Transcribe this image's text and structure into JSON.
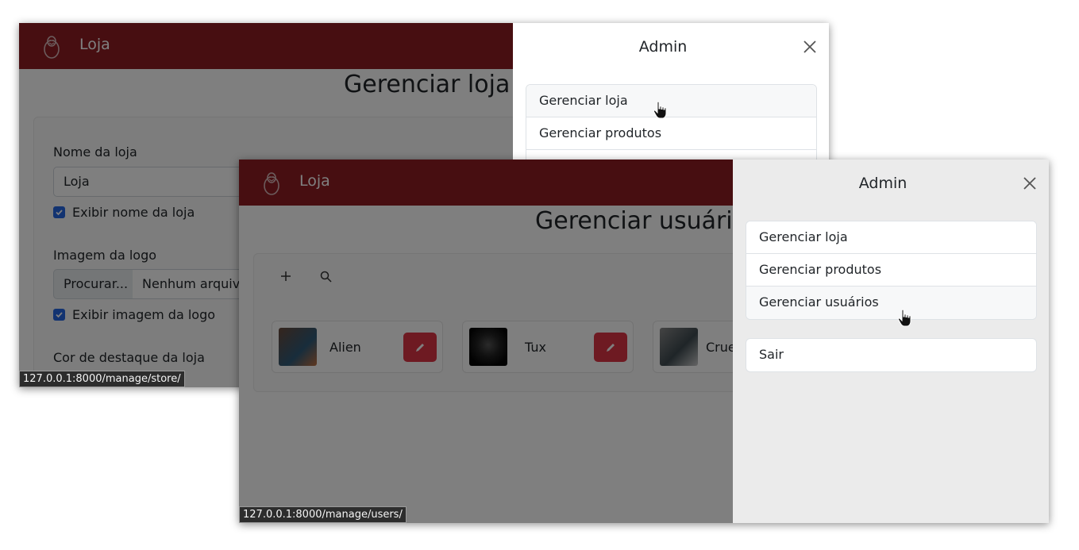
{
  "back_window": {
    "brand": {
      "name": "Loja",
      "logo_icon": "penguin-logo-icon"
    },
    "page_title": "Gerenciar loja",
    "form": {
      "store_name_label": "Nome da loja",
      "store_name_value": "Loja",
      "show_name_label": "Exibir nome da loja",
      "show_name_checked": true,
      "logo_label": "Imagem da logo",
      "browse_label": "Procurar...",
      "no_file_label": "Nenhum arquivo",
      "show_logo_label": "Exibir imagem da logo",
      "show_logo_checked": true,
      "accent_color_label": "Cor de destaque da loja"
    },
    "offcanvas": {
      "title": "Admin",
      "items": [
        "Gerenciar loja",
        "Gerenciar produtos"
      ]
    },
    "status_url": "127.0.0.1:8000/manage/store/"
  },
  "front_window": {
    "brand": {
      "name": "Loja",
      "logo_icon": "penguin-logo-icon"
    },
    "page_title": "Gerenciar usuário",
    "toolbar": {
      "add_icon": "plus-icon",
      "search_icon": "search-icon"
    },
    "users": [
      {
        "name": "Alien",
        "avatar_color": "#3a5a6e"
      },
      {
        "name": "Tux",
        "avatar_color": "#1c1c1c"
      },
      {
        "name": "Crue",
        "avatar_color": "#5a6468"
      }
    ],
    "offcanvas": {
      "title": "Admin",
      "items": [
        "Gerenciar loja",
        "Gerenciar produtos",
        "Gerenciar usuários"
      ],
      "logout": "Sair"
    },
    "status_url": "127.0.0.1:8000/manage/users/"
  },
  "colors": {
    "navbar": "#8e1c22",
    "checkbox": "#2566e3",
    "edit_button": "#dc3545",
    "backdrop": "rgba(0,0,0,0.5)"
  }
}
